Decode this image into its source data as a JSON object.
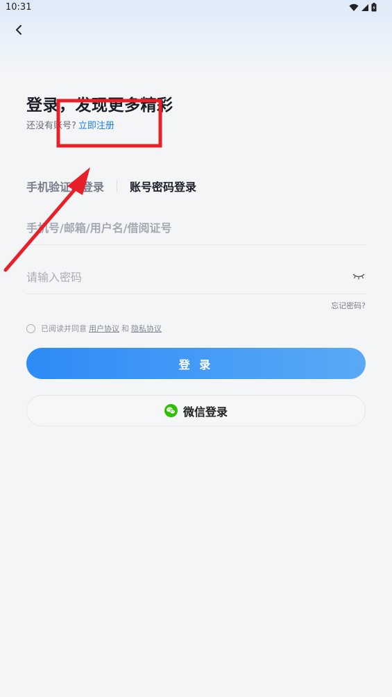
{
  "status_bar": {
    "time": "10:31",
    "icons": [
      "wifi-icon",
      "signal-icon",
      "battery-icon"
    ]
  },
  "header": {
    "back_icon": "chevron-left-icon"
  },
  "main": {
    "title": "登录，发现更多精彩",
    "subtitle_prefix": "还没有账号?",
    "register_link": "立即注册"
  },
  "tabs": {
    "phone_login": "手机验证码登录",
    "password_login": "账号密码登录",
    "active": "password_login"
  },
  "form": {
    "account_placeholder": "手机号/邮箱/用户名/借阅证号",
    "account_value": "",
    "password_placeholder": "请输入密码",
    "password_value": "",
    "forgot_label": "忘记密码?",
    "agree_prefix": "已阅读并同意",
    "user_agreement": "用户协议",
    "agree_and": "和",
    "privacy_agreement": "隐私协议",
    "agree_checked": false
  },
  "actions": {
    "login_label": "登 录",
    "wechat_label": "微信登录"
  },
  "colors": {
    "accent": "#1f7be8",
    "button_start": "#2d8bf6",
    "button_end": "#5aa9f6",
    "wechat_green": "#2dc100",
    "annotation_red": "#e8202a"
  }
}
